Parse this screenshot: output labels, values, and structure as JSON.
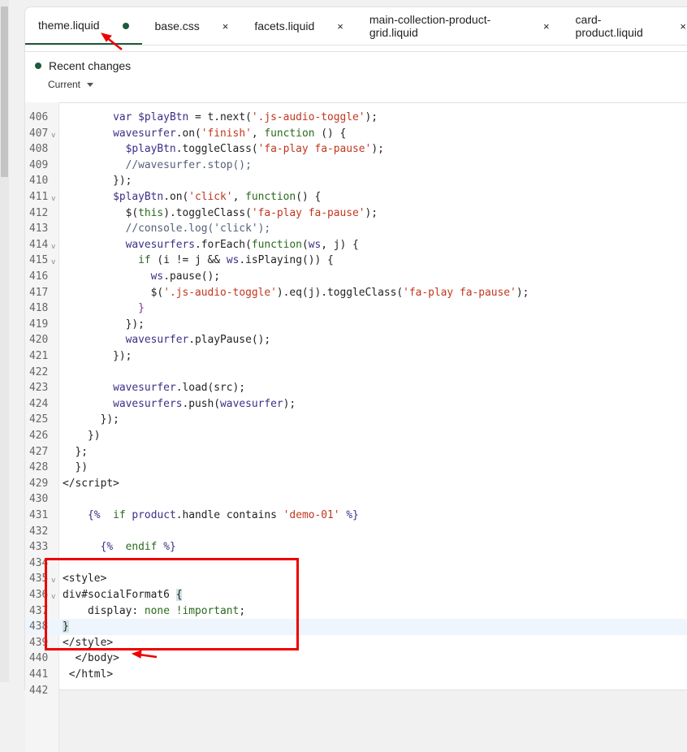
{
  "tabs": [
    {
      "label": "theme.liquid",
      "status": "modified-dot",
      "active": true
    },
    {
      "label": "base.css",
      "status": "close"
    },
    {
      "label": "facets.liquid",
      "status": "close"
    },
    {
      "label": "main-collection-product-grid.liquid",
      "status": "close"
    },
    {
      "label": "card-product.liquid",
      "status": "close"
    }
  ],
  "close_glyph": "×",
  "recent_changes": {
    "title": "Recent changes",
    "version": "Current"
  },
  "current_line": 438,
  "code_lines": [
    {
      "n": "406",
      "t": [
        [
          "p",
          "        "
        ],
        [
          "v",
          "var $playBtn"
        ],
        [
          "p",
          " = t.next("
        ],
        [
          "s",
          "'.js-audio-toggle'"
        ],
        [
          "p",
          ");"
        ]
      ]
    },
    {
      "n": "407",
      "f": true,
      "t": [
        [
          "p",
          "        "
        ],
        [
          "v",
          "wavesurfer"
        ],
        [
          "p",
          ".on("
        ],
        [
          "s",
          "'finish'"
        ],
        [
          "p",
          ", "
        ],
        [
          "k",
          "function"
        ],
        [
          "p",
          " () {"
        ]
      ]
    },
    {
      "n": "408",
      "t": [
        [
          "p",
          "          "
        ],
        [
          "v",
          "$playBtn"
        ],
        [
          "p",
          ".toggleClass("
        ],
        [
          "s",
          "'fa-play fa-pause'"
        ],
        [
          "p",
          ");"
        ]
      ]
    },
    {
      "n": "409",
      "t": [
        [
          "c",
          "          //wavesurfer.stop();"
        ]
      ]
    },
    {
      "n": "410",
      "t": [
        [
          "p",
          "        });"
        ]
      ]
    },
    {
      "n": "411",
      "f": true,
      "t": [
        [
          "p",
          "        "
        ],
        [
          "v",
          "$playBtn"
        ],
        [
          "p",
          ".on("
        ],
        [
          "s",
          "'click'"
        ],
        [
          "p",
          ", "
        ],
        [
          "k",
          "function"
        ],
        [
          "p",
          "() {"
        ]
      ]
    },
    {
      "n": "412",
      "t": [
        [
          "p",
          "          $("
        ],
        [
          "k",
          "this"
        ],
        [
          "p",
          ").toggleClass("
        ],
        [
          "s",
          "'fa-play fa-pause'"
        ],
        [
          "p",
          ");"
        ]
      ]
    },
    {
      "n": "413",
      "t": [
        [
          "c",
          "          //console.log('click');"
        ]
      ]
    },
    {
      "n": "414",
      "f": true,
      "t": [
        [
          "p",
          "          "
        ],
        [
          "v",
          "wavesurfers"
        ],
        [
          "p",
          ".forEach("
        ],
        [
          "k",
          "function"
        ],
        [
          "p",
          "("
        ],
        [
          "v",
          "ws"
        ],
        [
          "p",
          ", j) {"
        ]
      ]
    },
    {
      "n": "415",
      "f": true,
      "t": [
        [
          "p",
          "            "
        ],
        [
          "k",
          "if"
        ],
        [
          "p",
          " (i != j && "
        ],
        [
          "v",
          "ws"
        ],
        [
          "p",
          ".isPlaying()) {"
        ]
      ]
    },
    {
      "n": "416",
      "t": [
        [
          "p",
          "              "
        ],
        [
          "v",
          "ws"
        ],
        [
          "p",
          ".pause();"
        ]
      ]
    },
    {
      "n": "417",
      "t": [
        [
          "p",
          "              $("
        ],
        [
          "s",
          "'.js-audio-toggle'"
        ],
        [
          "p",
          ").eq(j).toggleClass("
        ],
        [
          "s",
          "'fa-play fa-pause'"
        ],
        [
          "p",
          ");"
        ]
      ]
    },
    {
      "n": "418",
      "t": [
        [
          "b",
          "            }"
        ]
      ]
    },
    {
      "n": "419",
      "t": [
        [
          "p",
          "          });"
        ]
      ]
    },
    {
      "n": "420",
      "t": [
        [
          "p",
          "          "
        ],
        [
          "v",
          "wavesurfer"
        ],
        [
          "p",
          ".playPause();"
        ]
      ]
    },
    {
      "n": "421",
      "t": [
        [
          "p",
          "        });"
        ]
      ]
    },
    {
      "n": "422",
      "t": [
        [
          "p",
          ""
        ]
      ]
    },
    {
      "n": "423",
      "t": [
        [
          "p",
          "        "
        ],
        [
          "v",
          "wavesurfer"
        ],
        [
          "p",
          ".load(src);"
        ]
      ]
    },
    {
      "n": "424",
      "t": [
        [
          "p",
          "        "
        ],
        [
          "v",
          "wavesurfers"
        ],
        [
          "p",
          ".push("
        ],
        [
          "v",
          "wavesurfer"
        ],
        [
          "p",
          ");"
        ]
      ]
    },
    {
      "n": "425",
      "t": [
        [
          "p",
          "      });"
        ]
      ]
    },
    {
      "n": "426",
      "t": [
        [
          "p",
          "    })"
        ]
      ]
    },
    {
      "n": "427",
      "t": [
        [
          "p",
          "  };"
        ]
      ]
    },
    {
      "n": "428",
      "t": [
        [
          "p",
          "  })"
        ]
      ]
    },
    {
      "n": "429",
      "t": [
        [
          "p",
          "</script>"
        ]
      ]
    },
    {
      "n": "430",
      "t": [
        [
          "p",
          ""
        ]
      ]
    },
    {
      "n": "431",
      "t": [
        [
          "p",
          "    "
        ],
        [
          "v",
          "{%"
        ],
        [
          "p",
          "  "
        ],
        [
          "k",
          "if"
        ],
        [
          "p",
          " "
        ],
        [
          "v",
          "product"
        ],
        [
          "p",
          ".handle contains "
        ],
        [
          "s",
          "'demo-01'"
        ],
        [
          "p",
          " "
        ],
        [
          "v",
          "%}"
        ]
      ]
    },
    {
      "n": "432",
      "t": [
        [
          "p",
          ""
        ]
      ]
    },
    {
      "n": "433",
      "t": [
        [
          "p",
          "      "
        ],
        [
          "v",
          "{%"
        ],
        [
          "p",
          "  "
        ],
        [
          "k",
          "endif"
        ],
        [
          "p",
          " "
        ],
        [
          "v",
          "%}"
        ]
      ]
    },
    {
      "n": "434",
      "t": [
        [
          "p",
          ""
        ]
      ]
    },
    {
      "n": "435",
      "f": true,
      "t": [
        [
          "p",
          "<style>"
        ]
      ]
    },
    {
      "n": "436",
      "f": true,
      "t": [
        [
          "p",
          "div#socialFormat6 "
        ],
        [
          "h",
          "{"
        ]
      ]
    },
    {
      "n": "437",
      "t": [
        [
          "p",
          "    display: "
        ],
        [
          "k",
          "none !important"
        ],
        [
          "p",
          ";"
        ]
      ]
    },
    {
      "n": "438",
      "t": [
        [
          "h",
          "}"
        ]
      ]
    },
    {
      "n": "439",
      "t": [
        [
          "p",
          "</style>"
        ]
      ]
    },
    {
      "n": "440",
      "t": [
        [
          "p",
          "  </body>"
        ]
      ]
    },
    {
      "n": "441",
      "t": [
        [
          "p",
          " </html>"
        ]
      ]
    },
    {
      "n": "442",
      "t": [
        [
          "p",
          ""
        ]
      ]
    }
  ],
  "colors": {
    "accent": "#1e5a3c",
    "annotation": "#ef0000"
  }
}
